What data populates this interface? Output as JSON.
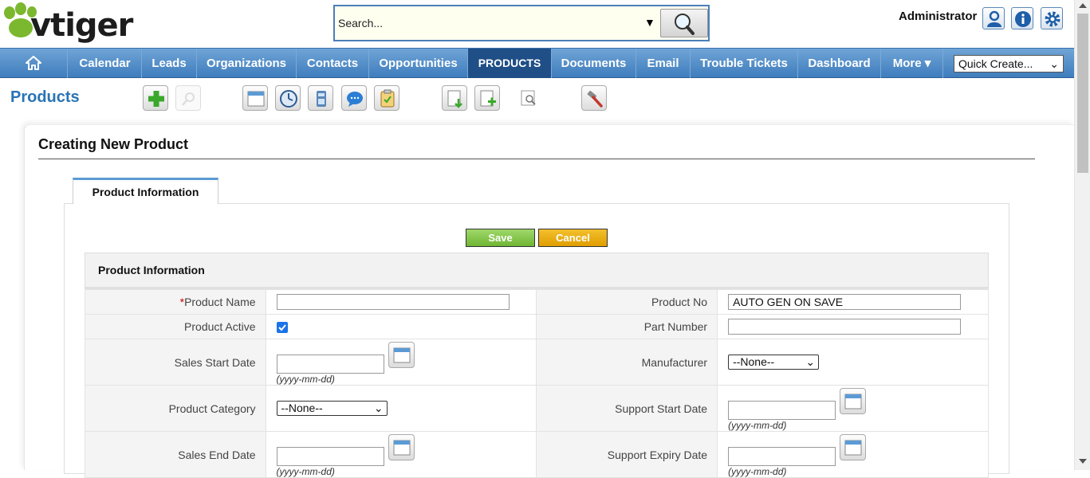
{
  "header": {
    "logo_text": "vtiger",
    "search": {
      "placeholder": "Search..."
    },
    "user": "Administrator",
    "icons": [
      "user-settings-icon",
      "info-icon",
      "gear-icon"
    ]
  },
  "nav": {
    "items": [
      {
        "label": "Calendar"
      },
      {
        "label": "Leads"
      },
      {
        "label": "Organizations"
      },
      {
        "label": "Contacts"
      },
      {
        "label": "Opportunities"
      },
      {
        "label": "PRODUCTS",
        "active": true
      },
      {
        "label": "Documents"
      },
      {
        "label": "Email"
      },
      {
        "label": "Trouble Tickets"
      },
      {
        "label": "Dashboard"
      },
      {
        "label": "More ▾"
      }
    ],
    "quick_create": "Quick Create..."
  },
  "module": {
    "title": "Products",
    "toolbar_icons": [
      "add-icon",
      "search-icon",
      "calendar-icon",
      "clock-icon",
      "calculator-icon",
      "chat-icon",
      "clipboard-icon",
      "import-icon",
      "export-icon",
      "find-duplicates-icon",
      "settings-hammer-icon"
    ]
  },
  "page": {
    "title": "Creating New Product",
    "tab": "Product Information",
    "save_label": "Save",
    "cancel_label": "Cancel",
    "section_title": "Product Information",
    "fields": {
      "product_name": {
        "label": "Product Name",
        "required": "*",
        "value": ""
      },
      "product_no": {
        "label": "Product No",
        "value": "AUTO GEN ON SAVE"
      },
      "product_active": {
        "label": "Product Active",
        "checked": true
      },
      "part_number": {
        "label": "Part Number",
        "value": ""
      },
      "sales_start_date": {
        "label": "Sales Start Date",
        "format": "(yyyy-mm-dd)"
      },
      "manufacturer": {
        "label": "Manufacturer",
        "value": "--None--"
      },
      "product_category": {
        "label": "Product Category",
        "value": "--None--"
      },
      "support_start_date": {
        "label": "Support Start Date",
        "format": "(yyyy-mm-dd)"
      },
      "sales_end_date": {
        "label": "Sales End Date",
        "format": "(yyyy-mm-dd)"
      },
      "support_expiry_date": {
        "label": "Support Expiry Date",
        "format": "(yyyy-mm-dd)"
      }
    }
  },
  "colors": {
    "nav_blue": "#4a86c5",
    "nav_active": "#1f4f86",
    "save_green": "#7fc241",
    "cancel_orange": "#e9a90f",
    "module_title": "#2a74b5"
  }
}
